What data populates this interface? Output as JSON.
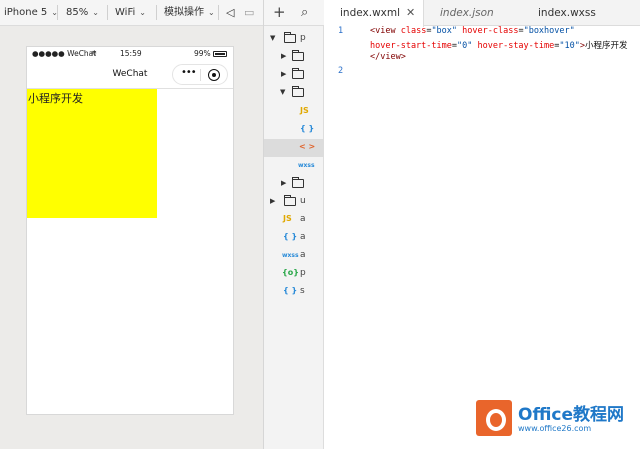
{
  "simulator": {
    "toolbar": {
      "device": "iPhone 5",
      "zoom": "85%",
      "network": "WiFi",
      "operation": "模拟操作"
    },
    "statusbar": {
      "carrier": "●●●●● WeChat",
      "time": "15:59",
      "battery": "99%"
    },
    "navbar": {
      "title": "WeChat",
      "dots": "•••"
    },
    "box_text": "小程序开发"
  },
  "file_tree": {
    "toolbar": {
      "add": "+",
      "search": "⌕"
    },
    "rows": [
      {
        "label": "p",
        "kind": "folder-open"
      },
      {
        "label": "",
        "kind": "folder"
      },
      {
        "label": "",
        "kind": "folder"
      },
      {
        "label": "",
        "kind": "folder-open"
      },
      {
        "label": "",
        "kind": "js",
        "icon": "JS"
      },
      {
        "label": "",
        "kind": "json",
        "icon": "{ }"
      },
      {
        "label": "",
        "kind": "wxml",
        "icon": "< >"
      },
      {
        "label": "",
        "kind": "wxss",
        "icon": "wxss"
      },
      {
        "label": "",
        "kind": "folder"
      },
      {
        "label": "u",
        "kind": "folder"
      },
      {
        "label": "a",
        "kind": "js",
        "icon": "JS"
      },
      {
        "label": "a",
        "kind": "json",
        "icon": "{ }"
      },
      {
        "label": "a",
        "kind": "wxss",
        "icon": "wxss"
      },
      {
        "label": "p",
        "kind": "config",
        "icon": "{o}"
      },
      {
        "label": "s",
        "kind": "json",
        "icon": "{ }"
      }
    ]
  },
  "editor": {
    "tabs": [
      {
        "label": "index.wxml",
        "close": "✕"
      },
      {
        "label": "index.json"
      },
      {
        "label": "index.wxss"
      }
    ],
    "lines": [
      {
        "number": "1"
      },
      {
        "number": "2"
      }
    ],
    "code": {
      "l1_tag": "<view ",
      "l1_attr1": "class",
      "l1_eq1": "=",
      "l1_val1": "\"box\"",
      "l1_attr2": " hover-class",
      "l1_eq2": "=",
      "l1_val2": "\"boxhover\"",
      "l2_attr3": "hover-start-time",
      "l2_eq3": "=",
      "l2_val3": "\"0\"",
      "l2_attr4": " hover-stay-time",
      "l2_eq4": "=",
      "l2_val4": "\"10\"",
      "l2_close": ">",
      "l2_text": "小程序开发",
      "l3_end": "</view>"
    }
  },
  "watermark": {
    "title": "Office教程网",
    "sub": "www.office26.com"
  },
  "colors": {
    "box": "#ffff00",
    "line_number": "#2a6fc9",
    "tag": "#800000",
    "attribute": "#e50000",
    "string": "#0451a5",
    "brand_orange": "#e9652b",
    "brand_blue": "#1f78c8"
  }
}
